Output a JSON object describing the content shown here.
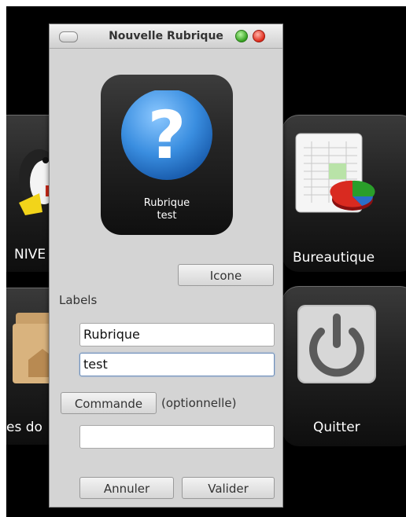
{
  "background": {
    "tiles": [
      {
        "label": "NIVE",
        "icon": "penguin-icon"
      },
      {
        "label": "Bureautique",
        "icon": "spreadsheet-icon"
      },
      {
        "label": "es do",
        "icon": "folder-icon"
      },
      {
        "label": "Quitter",
        "icon": "power-icon"
      }
    ]
  },
  "dialog": {
    "title": "Nouvelle Rubrique",
    "preview": {
      "line1": "Rubrique",
      "line2": "test",
      "icon": "question-mark-icon"
    },
    "icon_button": "Icone",
    "labels_heading": "Labels",
    "label1_value": "Rubrique",
    "label2_value": "test",
    "command_button": "Commande",
    "command_hint": "(optionnelle)",
    "command_value": "",
    "cancel_button": "Annuler",
    "ok_button": "Valider"
  },
  "colors": {
    "question_blue": "#3a8ee0",
    "dialog_bg": "#d4d4d4"
  }
}
